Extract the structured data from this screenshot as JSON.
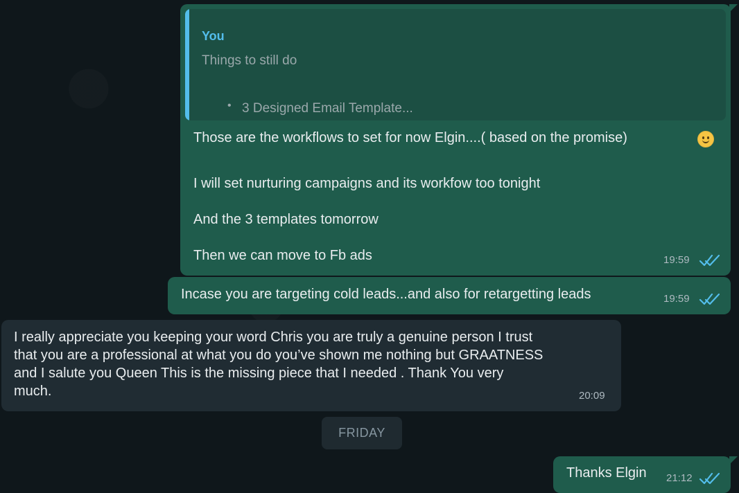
{
  "chat": {
    "messages": [
      {
        "reply_quote": {
          "author": "You",
          "line": "Things to still do",
          "item": "3 Designed Email Template..."
        },
        "lines": [
          "Those are the workflows to set for now Elgin....( based on the promise)",
          "I will set nurturing campaigns and its workfow too tonight",
          "And the 3 templates tomorrow",
          "Then we can move to Fb ads"
        ],
        "time": "19:59"
      },
      {
        "lines": [
          "Incase you are targeting cold leads...and also for retargetting leads"
        ],
        "time": "19:59"
      },
      {
        "lines": [
          "I really appreciate you keeping your word Chris you are truly a genuine person I trust",
          "that you are a professional at what you do you’ve shown me nothing but GRAATNESS",
          "and I salute you Queen This is the missing piece that I needed . Thank You very",
          "much."
        ],
        "time": "20:09"
      },
      {
        "lines": [
          "Thanks Elgin"
        ],
        "time": "21:12"
      }
    ],
    "day_separator": "FRIDAY"
  },
  "icons": {
    "read_receipt": "double-check-icon",
    "emoji": "slightly-smiling-face-icon"
  },
  "colors": {
    "outgoing_bubble": "#1f5c4c",
    "incoming_bubble": "#202c33",
    "quote_accent": "#53bdeb",
    "read_ticks": "#53bdeb",
    "background": "#0f171b"
  }
}
